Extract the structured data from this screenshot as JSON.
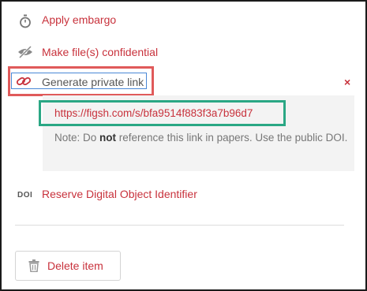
{
  "actions": {
    "embargo_label": "Apply embargo",
    "confidential_label": "Make file(s) confidential",
    "private_link_label": "Generate private link",
    "close_symbol": "×",
    "reserve_doi_label": "Reserve Digital Object Identifier",
    "doi_icon_text": "DOI"
  },
  "private_link": {
    "url": "https://figsh.com/s/bfa9514f883f3a7b96d7",
    "note_prefix": "Note: Do ",
    "note_bold": "not",
    "note_suffix": " reference this link in papers. Use the public DOI."
  },
  "footer": {
    "delete_label": "Delete item"
  },
  "colors": {
    "link": "#c8323c",
    "highlight_red": "#e05a5a",
    "highlight_green": "#2aa784",
    "focus_blue": "#4a88d6",
    "panel_bg": "#f3f3f3"
  }
}
